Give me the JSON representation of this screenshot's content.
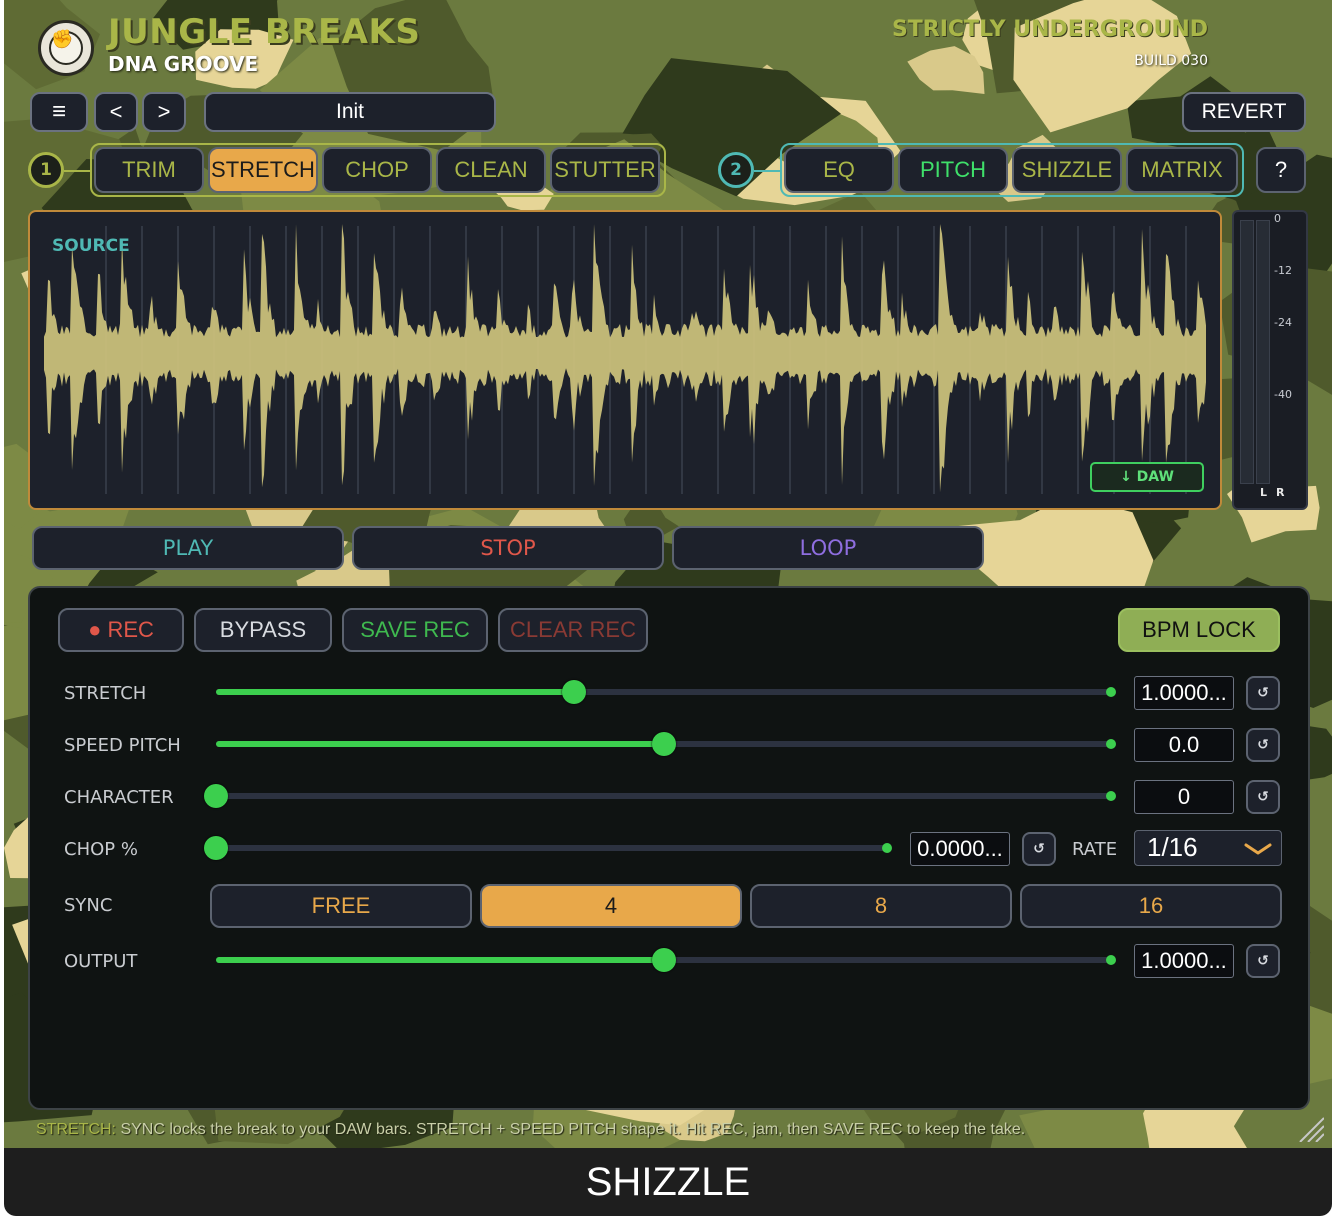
{
  "header": {
    "title": "JUNGLE BREAKS",
    "subtitle": "DNA GROOVE",
    "tagline": "STRICTLY UNDERGROUND",
    "build": "BUILD 030"
  },
  "toolbar": {
    "menu_icon": "hamburger-menu-icon",
    "menu_glyph": "≡",
    "prev_label": "<",
    "next_label": ">",
    "preset_name": "Init",
    "revert_label": "REVERT"
  },
  "tabs": {
    "group1_number": "1",
    "group1": [
      "TRIM",
      "STRETCH",
      "CHOP",
      "CLEAN",
      "STUTTER"
    ],
    "group1_active": "STRETCH",
    "group2_number": "2",
    "group2": [
      "EQ",
      "PITCH",
      "SHIZZLE",
      "MATRIX"
    ],
    "help_label": "?"
  },
  "waveform": {
    "source_label": "SOURCE",
    "daw_label": "↓ DAW",
    "fill_color": "#c9c07a"
  },
  "meter": {
    "ticks": [
      "0",
      "-12",
      "-24",
      "-40"
    ],
    "left_label": "L",
    "right_label": "R"
  },
  "transport": {
    "play": "PLAY",
    "stop": "STOP",
    "loop": "LOOP",
    "play_color": "#4fb9b4",
    "stop_color": "#e0574a",
    "loop_color": "#8f6ee0"
  },
  "record_bar": {
    "rec": "● REC",
    "bypass": "BYPASS",
    "save_rec": "SAVE REC",
    "clear_rec": "CLEAR REC",
    "bpm_lock": "BPM LOCK"
  },
  "controls": {
    "stretch": {
      "label": "STRETCH",
      "value": "1.0000...",
      "level": 0.4
    },
    "speed_pitch": {
      "label": "SPEED PITCH",
      "value": "0.0",
      "level": 0.5
    },
    "character": {
      "label": "CHARACTER",
      "value": "0",
      "level": 0.0
    },
    "chop": {
      "label": "CHOP %",
      "value": "0.0000...",
      "level": 0.0
    },
    "rate": {
      "label": "RATE",
      "value": "1/16"
    },
    "sync": {
      "label": "SYNC",
      "options": [
        "FREE",
        "4",
        "8",
        "16"
      ],
      "selected": "4"
    },
    "output": {
      "label": "OUTPUT",
      "value": "1.0000...",
      "level": 0.5
    },
    "reset_glyph": "↺"
  },
  "help": {
    "key": "STRETCH:",
    "text": " SYNC locks the break to your DAW bars. STRETCH + SPEED PITCH shape it. Hit REC, jam, then SAVE REC to keep the take."
  },
  "footer": {
    "title": "SHIZZLE"
  }
}
